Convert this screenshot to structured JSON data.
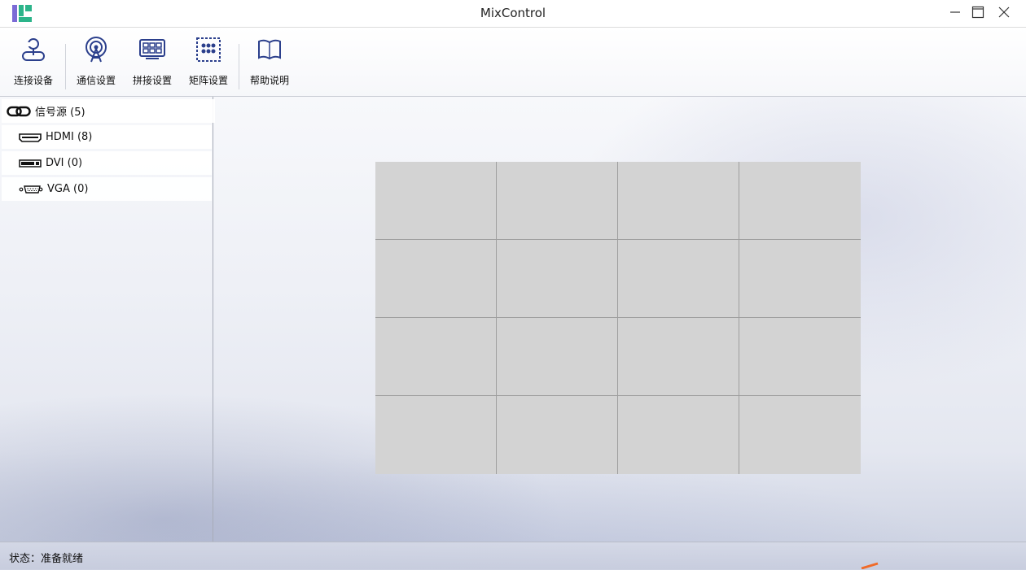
{
  "window": {
    "title": "MixControl",
    "minimize_symbol": "—",
    "maximize_symbol": "☐",
    "close_symbol": "✕"
  },
  "toolbar": {
    "items": [
      {
        "label": "连接设备",
        "icon": "connect-device-icon"
      },
      {
        "label": "通信设置",
        "icon": "broadcast-antenna-icon"
      },
      {
        "label": "拼接设置",
        "icon": "splice-grid-icon"
      },
      {
        "label": "矩阵设置",
        "icon": "matrix-dots-icon"
      },
      {
        "label": "帮助说明",
        "icon": "book-icon"
      }
    ]
  },
  "sidebar": {
    "root": {
      "label": "信号源 (5)",
      "icon": "link-icon"
    },
    "children": [
      {
        "label": "HDMI (8)",
        "icon": "hdmi-port-icon"
      },
      {
        "label": "DVI (0)",
        "icon": "dvi-port-icon"
      },
      {
        "label": "VGA (0)",
        "icon": "vga-port-icon"
      }
    ]
  },
  "canvas": {
    "rows": 4,
    "cols": 4,
    "cell_color": "#d3d3d3"
  },
  "status": {
    "text": "状态：准备就绪"
  },
  "colors": {
    "accent_icon": "#2b3f8c",
    "logo_purple": "#7b6bd6",
    "logo_green": "#2cb48a"
  }
}
